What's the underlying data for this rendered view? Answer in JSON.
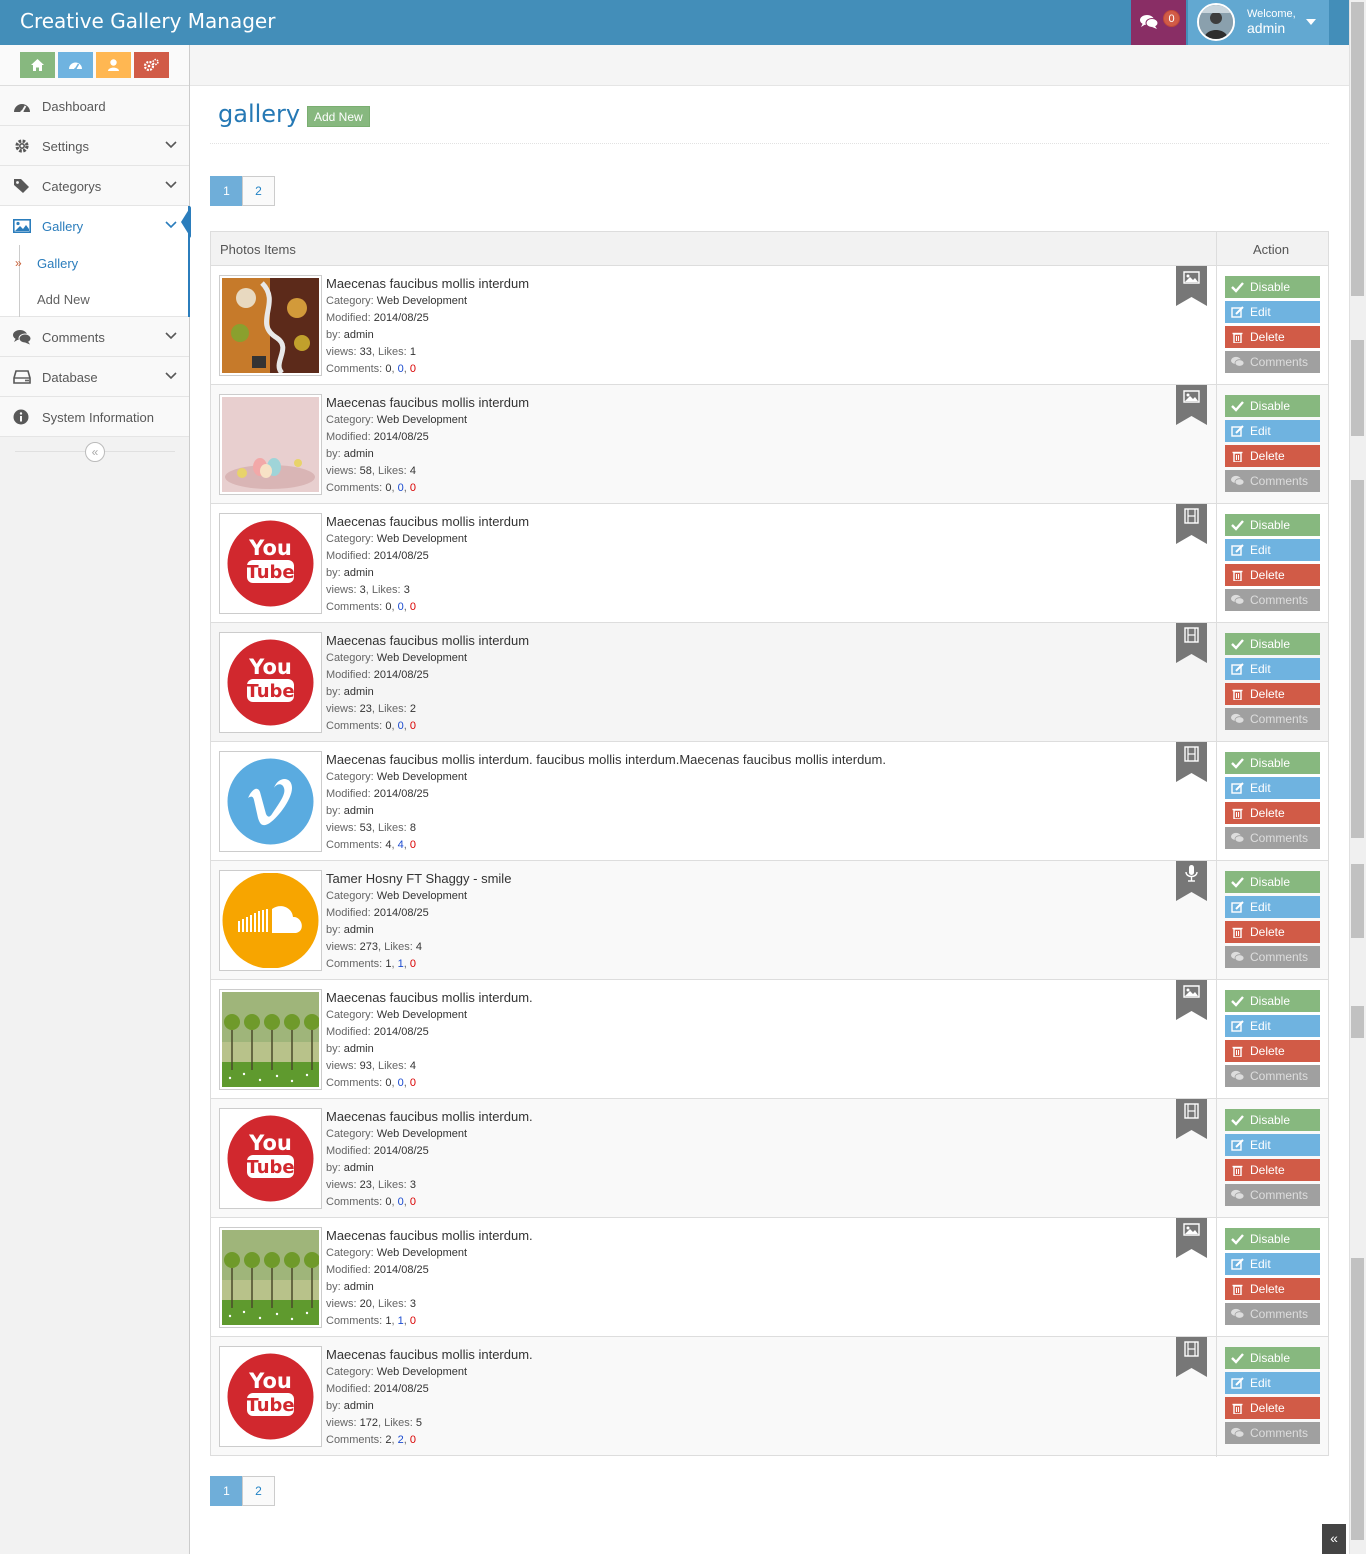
{
  "app": {
    "title": "Creative Gallery Manager",
    "messages_count": "0",
    "welcome": "Welcome,",
    "username": "admin"
  },
  "colors": {
    "navbar": "#438eb9",
    "accent": "#2b7dbc",
    "success": "#87b87f",
    "info": "#6fb3e0",
    "danger": "#d15b47",
    "muted": "#a0a0a0",
    "warning": "#ffb752",
    "messages": "#892e65"
  },
  "shortcuts": [
    {
      "icon": "home-icon",
      "color": "#87b87f"
    },
    {
      "icon": "dashboard-icon",
      "color": "#6fb3e0"
    },
    {
      "icon": "user-icon",
      "color": "#ffb752"
    },
    {
      "icon": "cogs-icon",
      "color": "#d15b47"
    }
  ],
  "sidebar": {
    "items": [
      {
        "label": "Dashboard",
        "icon": "dashboard-icon"
      },
      {
        "label": "Settings",
        "icon": "gear-icon"
      },
      {
        "label": "Categorys",
        "icon": "tag-icon"
      },
      {
        "label": "Gallery",
        "icon": "picture-icon"
      },
      {
        "label": "Comments",
        "icon": "comments-icon"
      },
      {
        "label": "Database",
        "icon": "database-icon"
      },
      {
        "label": "System Information",
        "icon": "info-icon"
      }
    ],
    "gallery_sub": [
      {
        "label": "Gallery"
      },
      {
        "label": "Add New"
      }
    ]
  },
  "page": {
    "title": "gallery",
    "add_new": "Add New"
  },
  "pagination": {
    "pages": [
      "1",
      "2"
    ],
    "current": "1"
  },
  "table": {
    "col_items": "Photos Items",
    "col_action": "Action"
  },
  "labels": {
    "category": "Category:",
    "modified": "Modified:",
    "by": "by:",
    "views": "views:",
    "likes": "Likes:",
    "comments": "Comments:"
  },
  "actions": {
    "disable": "Disable",
    "edit": "Edit",
    "delete": "Delete",
    "comments": "Comments"
  },
  "items": [
    {
      "title": "Maecenas faucibus mollis interdum",
      "category": "Web Development",
      "modified": "2014/08/25",
      "by": "admin",
      "views": "33",
      "likes": "1",
      "c1": "0",
      "c2": "0",
      "c3": "0",
      "type_icon": "image-icon",
      "thumb": "artwork-tree"
    },
    {
      "title": "Maecenas faucibus mollis interdum",
      "category": "Web Development",
      "modified": "2014/08/25",
      "by": "admin",
      "views": "58",
      "likes": "4",
      "c1": "0",
      "c2": "0",
      "c3": "0",
      "type_icon": "image-icon",
      "thumb": "easter-eggs"
    },
    {
      "title": "Maecenas faucibus mollis interdum",
      "category": "Web Development",
      "modified": "2014/08/25",
      "by": "admin",
      "views": "3",
      "likes": "3",
      "c1": "0",
      "c2": "0",
      "c3": "0",
      "type_icon": "film-icon",
      "thumb": "youtube"
    },
    {
      "title": "Maecenas faucibus mollis interdum",
      "category": "Web Development",
      "modified": "2014/08/25",
      "by": "admin",
      "views": "23",
      "likes": "2",
      "c1": "0",
      "c2": "0",
      "c3": "0",
      "type_icon": "film-icon",
      "thumb": "youtube"
    },
    {
      "title": "Maecenas faucibus mollis interdum. faucibus mollis interdum.Maecenas faucibus mollis interdum.",
      "category": "Web Development",
      "modified": "2014/08/25",
      "by": "admin",
      "views": "53",
      "likes": "8",
      "c1": "4",
      "c2": "4",
      "c3": "0",
      "type_icon": "film-icon",
      "thumb": "vimeo"
    },
    {
      "title": "Tamer Hosny FT Shaggy - smile",
      "category": "Web Development",
      "modified": "2014/08/25",
      "by": "admin",
      "views": "273",
      "likes": "4",
      "c1": "1",
      "c2": "1",
      "c3": "0",
      "type_icon": "microphone-icon",
      "thumb": "soundcloud"
    },
    {
      "title": "Maecenas faucibus mollis interdum.",
      "category": "Web Development",
      "modified": "2014/08/25",
      "by": "admin",
      "views": "93",
      "likes": "4",
      "c1": "0",
      "c2": "0",
      "c3": "0",
      "type_icon": "image-icon",
      "thumb": "trees"
    },
    {
      "title": "Maecenas faucibus mollis interdum.",
      "category": "Web Development",
      "modified": "2014/08/25",
      "by": "admin",
      "views": "23",
      "likes": "3",
      "c1": "0",
      "c2": "0",
      "c3": "0",
      "type_icon": "film-icon",
      "thumb": "youtube"
    },
    {
      "title": "Maecenas faucibus mollis interdum.",
      "category": "Web Development",
      "modified": "2014/08/25",
      "by": "admin",
      "views": "20",
      "likes": "3",
      "c1": "1",
      "c2": "1",
      "c3": "0",
      "type_icon": "image-icon",
      "thumb": "trees"
    },
    {
      "title": "Maecenas faucibus mollis interdum.",
      "category": "Web Development",
      "modified": "2014/08/25",
      "by": "admin",
      "views": "172",
      "likes": "5",
      "c1": "2",
      "c2": "2",
      "c3": "0",
      "type_icon": "film-icon",
      "thumb": "youtube"
    }
  ]
}
